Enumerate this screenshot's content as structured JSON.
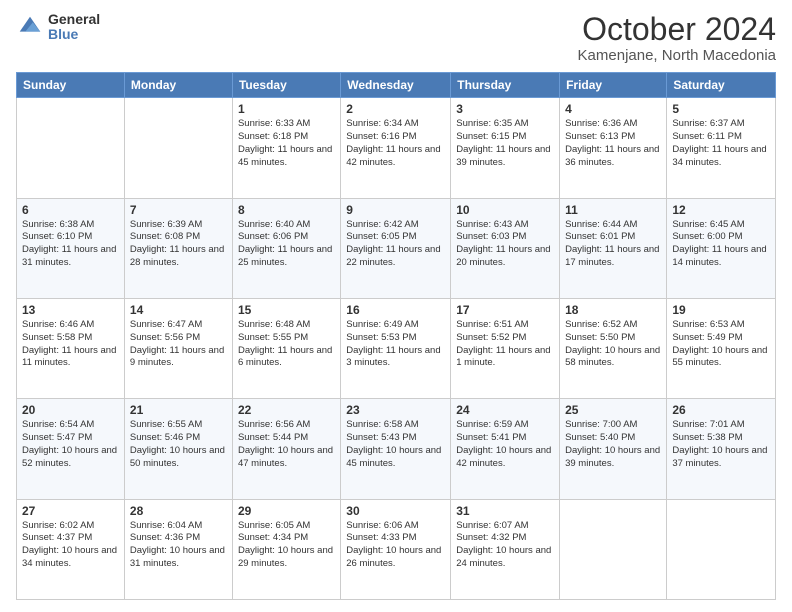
{
  "logo": {
    "general": "General",
    "blue": "Blue"
  },
  "title": "October 2024",
  "location": "Kamenjane, North Macedonia",
  "days_of_week": [
    "Sunday",
    "Monday",
    "Tuesday",
    "Wednesday",
    "Thursday",
    "Friday",
    "Saturday"
  ],
  "weeks": [
    [
      {
        "day": "",
        "sunrise": "",
        "sunset": "",
        "daylight": ""
      },
      {
        "day": "",
        "sunrise": "",
        "sunset": "",
        "daylight": ""
      },
      {
        "day": "1",
        "sunrise": "Sunrise: 6:33 AM",
        "sunset": "Sunset: 6:18 PM",
        "daylight": "Daylight: 11 hours and 45 minutes."
      },
      {
        "day": "2",
        "sunrise": "Sunrise: 6:34 AM",
        "sunset": "Sunset: 6:16 PM",
        "daylight": "Daylight: 11 hours and 42 minutes."
      },
      {
        "day": "3",
        "sunrise": "Sunrise: 6:35 AM",
        "sunset": "Sunset: 6:15 PM",
        "daylight": "Daylight: 11 hours and 39 minutes."
      },
      {
        "day": "4",
        "sunrise": "Sunrise: 6:36 AM",
        "sunset": "Sunset: 6:13 PM",
        "daylight": "Daylight: 11 hours and 36 minutes."
      },
      {
        "day": "5",
        "sunrise": "Sunrise: 6:37 AM",
        "sunset": "Sunset: 6:11 PM",
        "daylight": "Daylight: 11 hours and 34 minutes."
      }
    ],
    [
      {
        "day": "6",
        "sunrise": "Sunrise: 6:38 AM",
        "sunset": "Sunset: 6:10 PM",
        "daylight": "Daylight: 11 hours and 31 minutes."
      },
      {
        "day": "7",
        "sunrise": "Sunrise: 6:39 AM",
        "sunset": "Sunset: 6:08 PM",
        "daylight": "Daylight: 11 hours and 28 minutes."
      },
      {
        "day": "8",
        "sunrise": "Sunrise: 6:40 AM",
        "sunset": "Sunset: 6:06 PM",
        "daylight": "Daylight: 11 hours and 25 minutes."
      },
      {
        "day": "9",
        "sunrise": "Sunrise: 6:42 AM",
        "sunset": "Sunset: 6:05 PM",
        "daylight": "Daylight: 11 hours and 22 minutes."
      },
      {
        "day": "10",
        "sunrise": "Sunrise: 6:43 AM",
        "sunset": "Sunset: 6:03 PM",
        "daylight": "Daylight: 11 hours and 20 minutes."
      },
      {
        "day": "11",
        "sunrise": "Sunrise: 6:44 AM",
        "sunset": "Sunset: 6:01 PM",
        "daylight": "Daylight: 11 hours and 17 minutes."
      },
      {
        "day": "12",
        "sunrise": "Sunrise: 6:45 AM",
        "sunset": "Sunset: 6:00 PM",
        "daylight": "Daylight: 11 hours and 14 minutes."
      }
    ],
    [
      {
        "day": "13",
        "sunrise": "Sunrise: 6:46 AM",
        "sunset": "Sunset: 5:58 PM",
        "daylight": "Daylight: 11 hours and 11 minutes."
      },
      {
        "day": "14",
        "sunrise": "Sunrise: 6:47 AM",
        "sunset": "Sunset: 5:56 PM",
        "daylight": "Daylight: 11 hours and 9 minutes."
      },
      {
        "day": "15",
        "sunrise": "Sunrise: 6:48 AM",
        "sunset": "Sunset: 5:55 PM",
        "daylight": "Daylight: 11 hours and 6 minutes."
      },
      {
        "day": "16",
        "sunrise": "Sunrise: 6:49 AM",
        "sunset": "Sunset: 5:53 PM",
        "daylight": "Daylight: 11 hours and 3 minutes."
      },
      {
        "day": "17",
        "sunrise": "Sunrise: 6:51 AM",
        "sunset": "Sunset: 5:52 PM",
        "daylight": "Daylight: 11 hours and 1 minute."
      },
      {
        "day": "18",
        "sunrise": "Sunrise: 6:52 AM",
        "sunset": "Sunset: 5:50 PM",
        "daylight": "Daylight: 10 hours and 58 minutes."
      },
      {
        "day": "19",
        "sunrise": "Sunrise: 6:53 AM",
        "sunset": "Sunset: 5:49 PM",
        "daylight": "Daylight: 10 hours and 55 minutes."
      }
    ],
    [
      {
        "day": "20",
        "sunrise": "Sunrise: 6:54 AM",
        "sunset": "Sunset: 5:47 PM",
        "daylight": "Daylight: 10 hours and 52 minutes."
      },
      {
        "day": "21",
        "sunrise": "Sunrise: 6:55 AM",
        "sunset": "Sunset: 5:46 PM",
        "daylight": "Daylight: 10 hours and 50 minutes."
      },
      {
        "day": "22",
        "sunrise": "Sunrise: 6:56 AM",
        "sunset": "Sunset: 5:44 PM",
        "daylight": "Daylight: 10 hours and 47 minutes."
      },
      {
        "day": "23",
        "sunrise": "Sunrise: 6:58 AM",
        "sunset": "Sunset: 5:43 PM",
        "daylight": "Daylight: 10 hours and 45 minutes."
      },
      {
        "day": "24",
        "sunrise": "Sunrise: 6:59 AM",
        "sunset": "Sunset: 5:41 PM",
        "daylight": "Daylight: 10 hours and 42 minutes."
      },
      {
        "day": "25",
        "sunrise": "Sunrise: 7:00 AM",
        "sunset": "Sunset: 5:40 PM",
        "daylight": "Daylight: 10 hours and 39 minutes."
      },
      {
        "day": "26",
        "sunrise": "Sunrise: 7:01 AM",
        "sunset": "Sunset: 5:38 PM",
        "daylight": "Daylight: 10 hours and 37 minutes."
      }
    ],
    [
      {
        "day": "27",
        "sunrise": "Sunrise: 6:02 AM",
        "sunset": "Sunset: 4:37 PM",
        "daylight": "Daylight: 10 hours and 34 minutes."
      },
      {
        "day": "28",
        "sunrise": "Sunrise: 6:04 AM",
        "sunset": "Sunset: 4:36 PM",
        "daylight": "Daylight: 10 hours and 31 minutes."
      },
      {
        "day": "29",
        "sunrise": "Sunrise: 6:05 AM",
        "sunset": "Sunset: 4:34 PM",
        "daylight": "Daylight: 10 hours and 29 minutes."
      },
      {
        "day": "30",
        "sunrise": "Sunrise: 6:06 AM",
        "sunset": "Sunset: 4:33 PM",
        "daylight": "Daylight: 10 hours and 26 minutes."
      },
      {
        "day": "31",
        "sunrise": "Sunrise: 6:07 AM",
        "sunset": "Sunset: 4:32 PM",
        "daylight": "Daylight: 10 hours and 24 minutes."
      },
      {
        "day": "",
        "sunrise": "",
        "sunset": "",
        "daylight": ""
      },
      {
        "day": "",
        "sunrise": "",
        "sunset": "",
        "daylight": ""
      }
    ]
  ]
}
